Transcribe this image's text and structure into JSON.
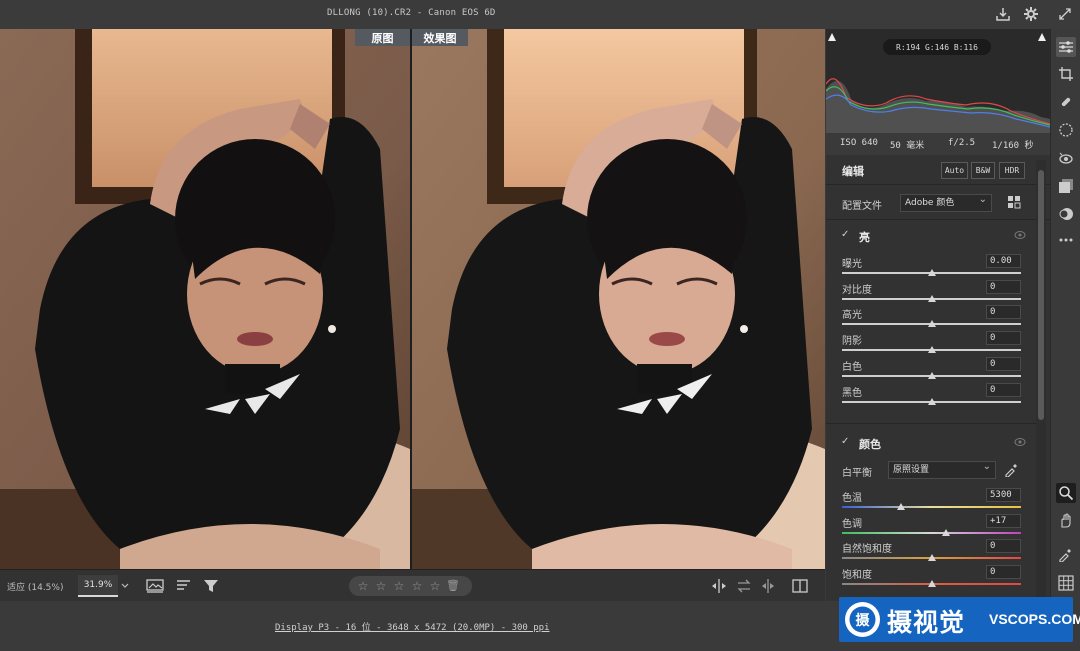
{
  "titlebar": {
    "title": "DLLONG (10).CR2 -  Canon EOS 6D"
  },
  "viewer": {
    "before_label": "原图",
    "after_label": "效果图"
  },
  "bottombar": {
    "zoom_fit": "适应 (14.5%)",
    "zoom_value": "31.9%",
    "rating_stars": 5
  },
  "statusbar": {
    "info": "Display P3 - 16 位 - 3648 x 5472 (20.0MP) - 300 ppi"
  },
  "panel": {
    "histogram": {
      "rgb_readout": "R:194  G:146  B:116"
    },
    "camera": {
      "iso": "ISO 640",
      "focal": "50 毫米",
      "aperture": "f/2.5",
      "shutter": "1/160 秒"
    },
    "edit": {
      "title": "编辑",
      "auto_label": "Auto",
      "bw_label": "B&W",
      "hdr_label": "HDR"
    },
    "profile": {
      "label": "配置文件",
      "value": "Adobe 颜色"
    },
    "light": {
      "title": "亮",
      "sliders": [
        {
          "label": "曝光",
          "value": "0.00",
          "position": 0.5
        },
        {
          "label": "对比度",
          "value": "0",
          "position": 0.5
        },
        {
          "label": "高光",
          "value": "0",
          "position": 0.5
        },
        {
          "label": "阴影",
          "value": "0",
          "position": 0.5
        },
        {
          "label": "白色",
          "value": "0",
          "position": 0.5
        },
        {
          "label": "黑色",
          "value": "0",
          "position": 0.5
        }
      ]
    },
    "color": {
      "title": "颜色",
      "wb_label": "白平衡",
      "wb_value": "原照设置",
      "sliders": [
        {
          "label": "色温",
          "value": "5300",
          "position": 0.33
        },
        {
          "label": "色调",
          "value": "+17",
          "position": 0.58
        },
        {
          "label": "自然饱和度",
          "value": "0",
          "position": 0.5
        },
        {
          "label": "饱和度",
          "value": "0",
          "position": 0.5
        }
      ]
    }
  },
  "watermark": {
    "cn": "摄视觉",
    "en": "VSCOPS.COM"
  },
  "colors": {
    "panel_bg": "#323232",
    "histo_red": "#e04848",
    "histo_green": "#3fbf5f",
    "histo_blue": "#4f7fe8"
  }
}
